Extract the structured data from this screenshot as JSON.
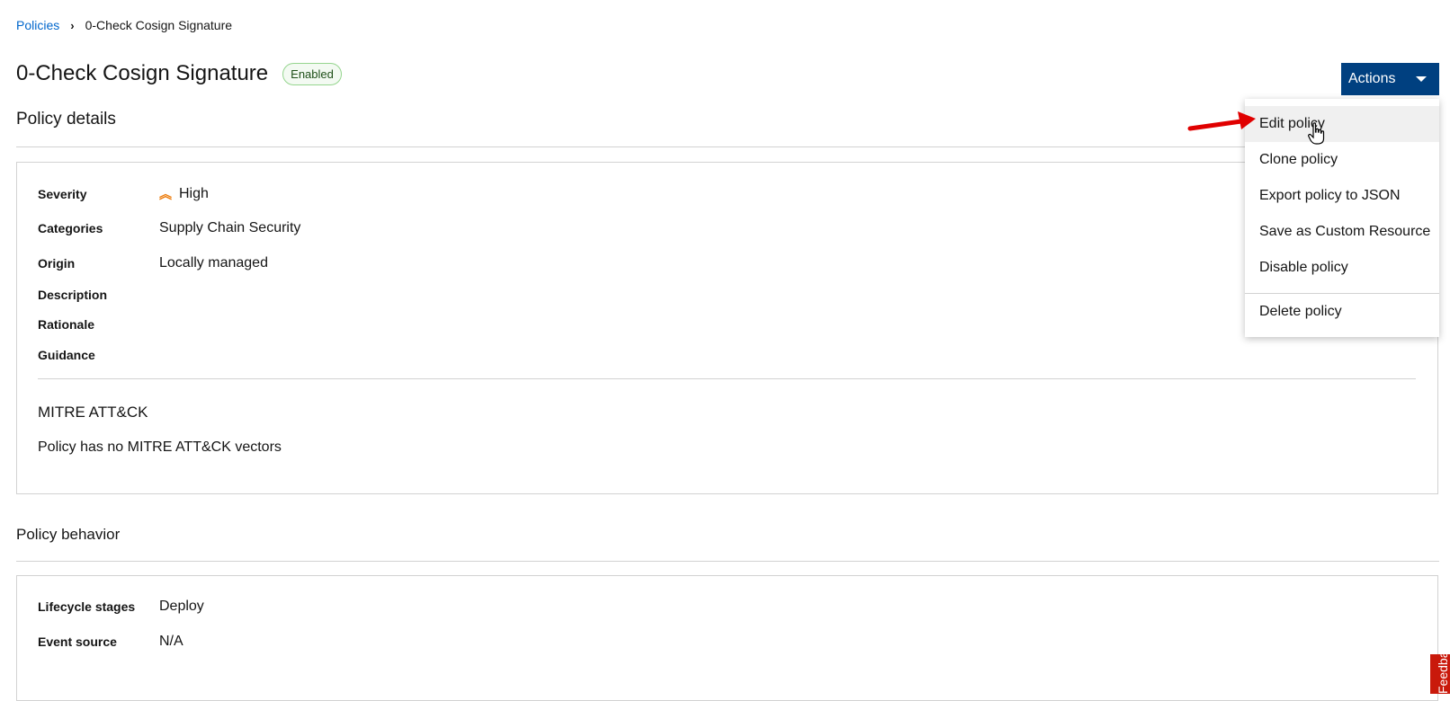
{
  "breadcrumb": {
    "parent": "Policies",
    "current": "0-Check Cosign Signature"
  },
  "header": {
    "title": "0-Check Cosign Signature",
    "status": "Enabled",
    "actions_label": "Actions"
  },
  "details": {
    "title": "Policy details",
    "rows": [
      {
        "label": "Severity",
        "value": "High"
      },
      {
        "label": "Categories",
        "value": "Supply Chain Security"
      },
      {
        "label": "Origin",
        "value": "Locally managed"
      },
      {
        "label": "Description",
        "value": ""
      },
      {
        "label": "Rationale",
        "value": ""
      },
      {
        "label": "Guidance",
        "value": ""
      }
    ],
    "mitre_title": "MITRE ATT&CK",
    "mitre_text": "Policy has no MITRE ATT&CK vectors"
  },
  "behavior": {
    "title": "Policy behavior",
    "rows": [
      {
        "label": "Lifecycle stages",
        "value": "Deploy"
      },
      {
        "label": "Event source",
        "value": "N/A"
      }
    ]
  },
  "actions_menu": {
    "items": [
      "Edit policy",
      "Clone policy",
      "Export policy to JSON",
      "Save as Custom Resource",
      "Disable policy"
    ],
    "danger_item": "Delete policy"
  },
  "feedback_label": "Feedback",
  "icons": {
    "severity": "double-chevron-up-icon",
    "annotation": "red-arrow",
    "cursor": "hand-pointer-icon"
  },
  "colors": {
    "primary": "#004080",
    "link": "#0066cc",
    "severity_high": "#ec7a08",
    "annotation_arrow": "#e00000",
    "feedback": "#c9190b"
  }
}
